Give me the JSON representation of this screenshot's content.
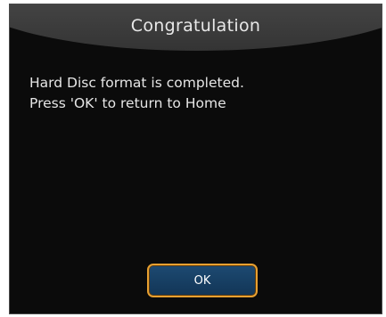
{
  "dialog": {
    "title": "Congratulation",
    "message_lines": [
      "Hard Disc format is completed.",
      "Press 'OK' to return to Home"
    ],
    "ok_label": "OK"
  },
  "colors": {
    "background": "#0b0b0b",
    "title_bar": "#4b4b4b",
    "button_fill": "#1d4a72",
    "button_border": "#e8a030",
    "text": "#e6e6e6"
  }
}
